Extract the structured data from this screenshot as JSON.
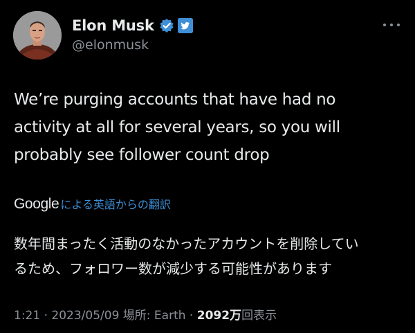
{
  "author": {
    "display_name": "Elon Musk",
    "handle": "@elonmusk",
    "verified_color": "#3d8fd6"
  },
  "tweet": {
    "text_lines": [
      "We’re purging accounts that have had no",
      "activity at all for several years, so you will",
      "probably see follower count drop"
    ]
  },
  "translation": {
    "provider": "Google",
    "label": "による英語からの翻訳",
    "text_lines": [
      "数年間まったく活動のなかったアカウントを削除してい",
      "るため、フォロワー数が減少する可能性があります"
    ]
  },
  "meta": {
    "time": "1:21",
    "date": "2023/05/09",
    "location": "場所: Earth",
    "views_count": "2092",
    "views_unit": "万",
    "views_label": "回表示",
    "separator": " · "
  },
  "icons": {
    "verified": "verified-badge-icon",
    "affiliate": "twitter-bird-icon",
    "more": "more-options-icon"
  }
}
